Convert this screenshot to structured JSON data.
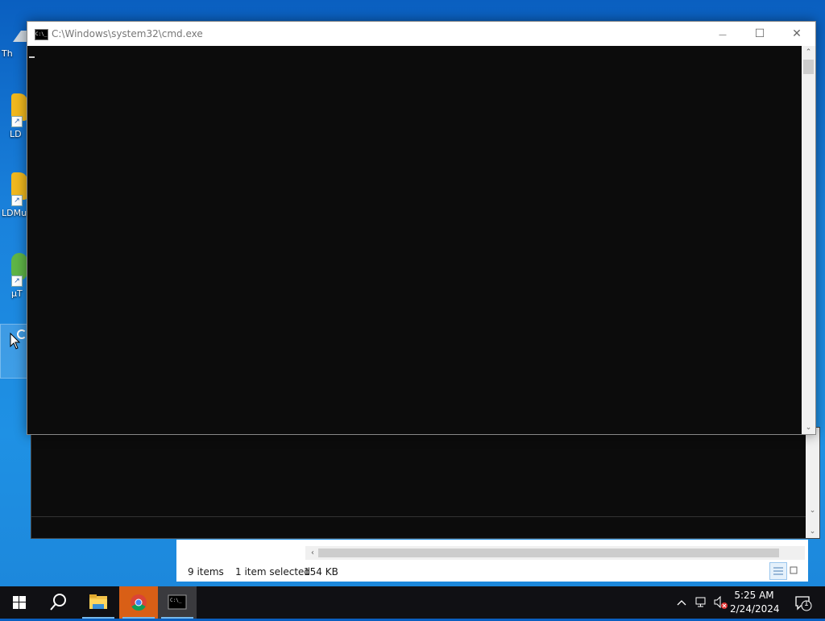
{
  "desktop": {
    "icons": [
      {
        "label": "Th"
      },
      {
        "label": "LD"
      },
      {
        "label": "LDMu"
      },
      {
        "label": "µT"
      }
    ]
  },
  "cmd_window": {
    "title": "C:\\Windows\\system32\\cmd.exe",
    "minimize_glyph": "—",
    "maximize_glyph": "☐",
    "close_glyph": "✕",
    "console_text": ""
  },
  "explorer": {
    "status_items": "9 items",
    "status_selected": "1 item selected",
    "status_size": "154 KB"
  },
  "taskbar": {
    "items": [
      "start-button",
      "search-button",
      "file-explorer",
      "google-chrome",
      "command-prompt"
    ],
    "clock_time": "5:25 AM",
    "clock_date": "2/24/2024",
    "notification_count": "1"
  },
  "colors": {
    "desktop": "#1a82dc",
    "console_bg": "#0c0c0c",
    "taskbar": "#101014",
    "accent": "#76b9ed"
  }
}
